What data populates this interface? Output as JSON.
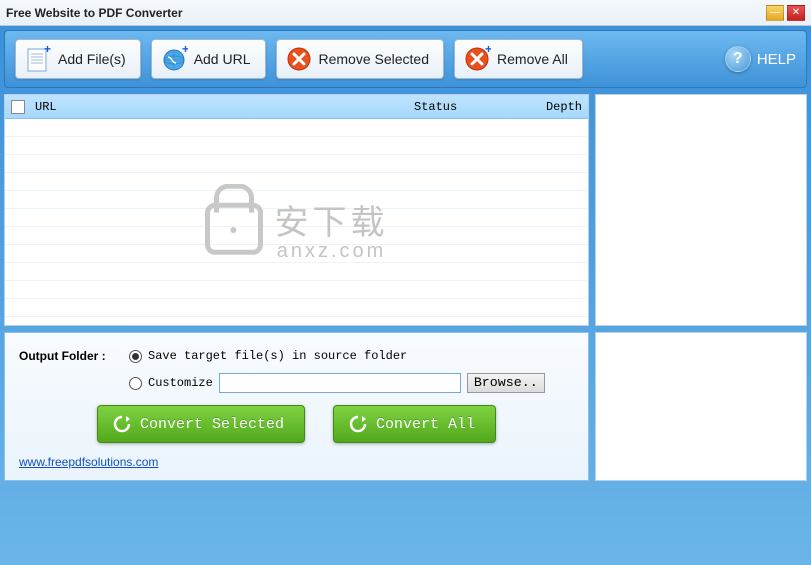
{
  "window": {
    "title": "Free Website to PDF Converter"
  },
  "toolbar": {
    "add_files": "Add File(s)",
    "add_url": "Add URL",
    "remove_selected": "Remove Selected",
    "remove_all": "Remove All",
    "help": "HELP"
  },
  "list": {
    "columns": {
      "url": "URL",
      "status": "Status",
      "depth": "Depth"
    },
    "rows": []
  },
  "watermark": {
    "cn": "安下载",
    "domain": "anxz.com"
  },
  "output": {
    "label": "Output Folder :",
    "save_source": "Save target file(s) in source folder",
    "customize": "Customize",
    "customize_path": "",
    "browse": "Browse..",
    "selected_option": "save_source"
  },
  "convert": {
    "selected": "Convert Selected",
    "all": "Convert All"
  },
  "link": {
    "url_text": "www.freepdfsolutions.com"
  }
}
